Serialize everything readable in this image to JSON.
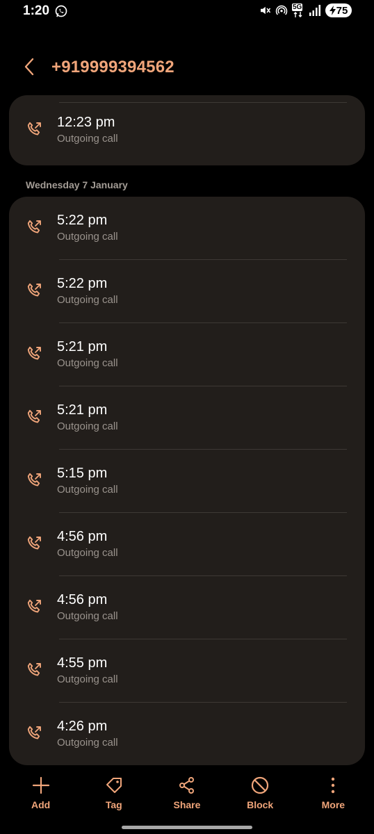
{
  "status_bar": {
    "time": "1:20",
    "network": "5G",
    "battery_level": "75",
    "icons": [
      "whatsapp-icon",
      "mute-icon",
      "hotspot-icon",
      "signal-icon",
      "charging-icon"
    ]
  },
  "header": {
    "title": "+919999394562",
    "back_icon": "chevron-left-icon"
  },
  "calls_top": [
    {
      "time": "12:23 pm",
      "type": "Outgoing call"
    }
  ],
  "section_date": "Wednesday 7 January",
  "calls": [
    {
      "time": "5:22 pm",
      "type": "Outgoing call"
    },
    {
      "time": "5:22 pm",
      "type": "Outgoing call"
    },
    {
      "time": "5:21 pm",
      "type": "Outgoing call"
    },
    {
      "time": "5:21 pm",
      "type": "Outgoing call"
    },
    {
      "time": "5:15 pm",
      "type": "Outgoing call"
    },
    {
      "time": "4:56 pm",
      "type": "Outgoing call"
    },
    {
      "time": "4:56 pm",
      "type": "Outgoing call"
    },
    {
      "time": "4:55 pm",
      "type": "Outgoing call"
    },
    {
      "time": "4:26 pm",
      "type": "Outgoing call"
    }
  ],
  "actions": [
    {
      "label": "Add",
      "icon": "plus-icon"
    },
    {
      "label": "Tag",
      "icon": "tag-icon"
    },
    {
      "label": "Share",
      "icon": "share-icon"
    },
    {
      "label": "Block",
      "icon": "block-icon"
    },
    {
      "label": "More",
      "icon": "more-vertical-icon"
    }
  ],
  "colors": {
    "accent": "#f0a57a",
    "card_bg": "#221e1b",
    "background": "#000000",
    "secondary_text": "#9a938d"
  }
}
